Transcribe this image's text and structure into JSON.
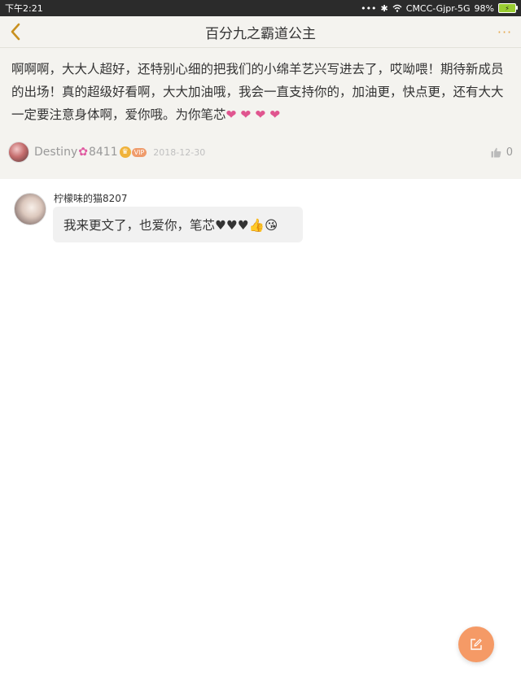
{
  "status_bar": {
    "time": "下午2:21",
    "carrier": "CMCC-Gjpr-5G",
    "battery": "98%"
  },
  "nav": {
    "title": "百分九之霸道公主",
    "back_icon": "chevron-left-icon",
    "more_icon": "more-dots-icon",
    "more_label": "···"
  },
  "post": {
    "text": "啊啊啊，大大人超好，还特别心细的把我们的小绵羊艺兴写进去了，哎呦喂！期待新成员的出场！真的超级好看啊，大大加油哦，我会一直支持你的，加油更，快点更，还有大大一定要注意身体啊，爱你哦。为你笔芯",
    "hearts": "❤ ❤ ❤ ❤",
    "author": "Destiny",
    "author_flower": "✿",
    "author_suffix": "8411",
    "vip_label": "VIP",
    "date": "2018-12-30",
    "like_count": "0"
  },
  "reply": {
    "author": "柠檬味的猫8207",
    "text": "我来更文了，也爱你，笔芯♥♥♥👍😘"
  },
  "colors": {
    "accent": "#e6a84d",
    "fab": "#f59a66",
    "heart": "#e0558f"
  }
}
